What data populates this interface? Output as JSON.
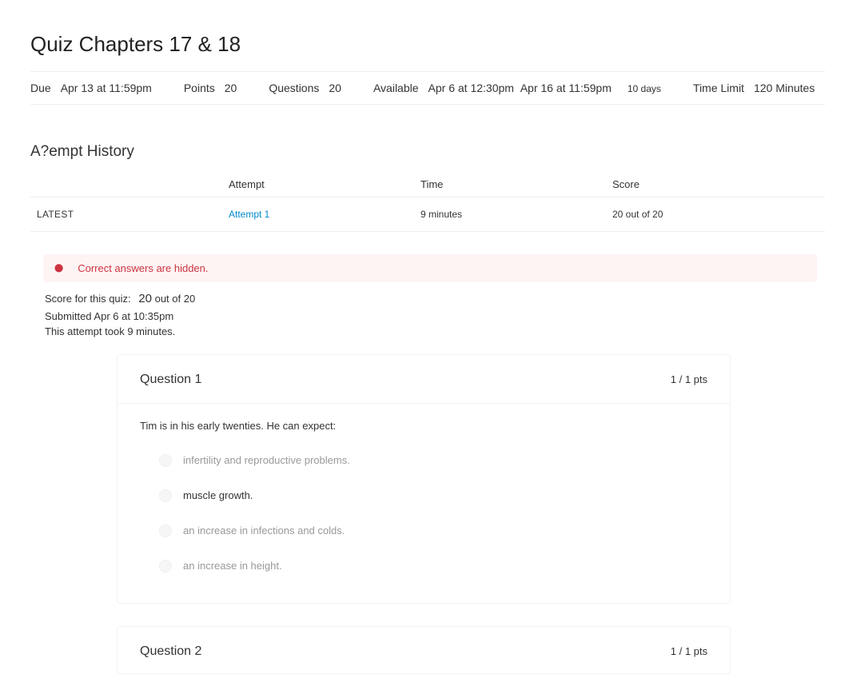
{
  "quiz": {
    "title": "Quiz Chapters 17 & 18",
    "meta": {
      "due_label": "Due",
      "due_value": "Apr 13 at 11:59pm",
      "points_label": "Points",
      "points_value": "20",
      "questions_label": "Questions",
      "questions_value": "20",
      "available_label": "Available",
      "available_start": "Apr 6 at 12:30pm",
      "available_end": "Apr 16 at 11:59pm",
      "available_days": "10 days",
      "time_limit_label": "Time Limit",
      "time_limit_value": "120 Minutes"
    }
  },
  "attempt_history": {
    "heading": "A?empt History",
    "columns": {
      "attempt": "Attempt",
      "time": "Time",
      "score": "Score"
    },
    "latest_label": "LATEST",
    "rows": [
      {
        "attempt": "Attempt 1",
        "time": "9 minutes",
        "score": "20 out of 20"
      }
    ]
  },
  "alert": {
    "text": "Correct answers are hidden."
  },
  "summary": {
    "score_label": "Score for this quiz:",
    "score_value": "20",
    "score_suffix": "out of 20",
    "submitted": "Submitted Apr 6 at 10:35pm",
    "duration": "This attempt took 9 minutes."
  },
  "questions": [
    {
      "number": "Question 1",
      "points": "1 / 1 pts",
      "text": "Tim is in his early twenties. He can expect:",
      "options": [
        {
          "text": "infertility and reproductive problems.",
          "selected": false
        },
        {
          "text": "muscle growth.",
          "selected": true
        },
        {
          "text": "an increase in infections and colds.",
          "selected": false
        },
        {
          "text": "an increase in height.",
          "selected": false
        }
      ]
    },
    {
      "number": "Question 2",
      "points": "1 / 1 pts"
    }
  ]
}
